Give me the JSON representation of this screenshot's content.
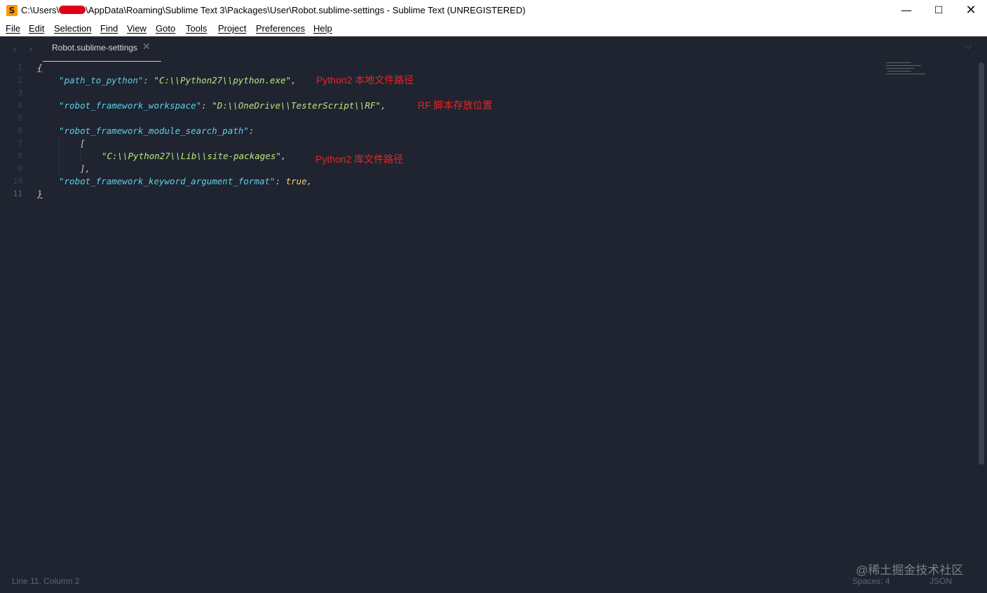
{
  "titlebar": {
    "title_prefix": "C:\\Users\\",
    "title_suffix": "\\AppData\\Roaming\\Sublime Text 3\\Packages\\User\\Robot.sublime-settings - Sublime Text (UNREGISTERED)",
    "app_icon_glyph": "S",
    "minimize": "—",
    "maximize": "☐",
    "close": "✕"
  },
  "menu": [
    "File",
    "Edit",
    "Selection",
    "Find",
    "View",
    "Goto",
    "Tools",
    "Project",
    "Preferences",
    "Help"
  ],
  "tabs": {
    "nav_back": "‹",
    "nav_forward": "›",
    "active_tab": {
      "label": "Robot.sublime-settings",
      "close": "✕"
    },
    "dropdown": "⌵"
  },
  "editor": {
    "line_numbers": [
      "1",
      "2",
      "3",
      "4",
      "5",
      "6",
      "7",
      "8",
      "9",
      "10",
      "11"
    ],
    "active_line": 11,
    "lines": {
      "l1": {
        "brace": "{"
      },
      "l2": {
        "key": "\"path_to_python\"",
        "colon": ": ",
        "value": "\"C:\\\\Python27\\\\python.exe\"",
        "comma": ","
      },
      "l4": {
        "key": "\"robot_framework_workspace\"",
        "colon": ": ",
        "value": "\"D:\\\\OneDrive\\\\TesterScript\\\\RF\"",
        "comma": ","
      },
      "l6": {
        "key": "\"robot_framework_module_search_path\"",
        "colon": ":"
      },
      "l7": {
        "bracket": "["
      },
      "l8": {
        "value": "\"C:\\\\Python27\\\\Lib\\\\site-packages\"",
        "comma": ","
      },
      "l9": {
        "bracket": "]",
        "comma": ","
      },
      "l10": {
        "key": "\"robot_framework_keyword_argument_format\"",
        "colon": ": ",
        "value": "true",
        "comma": ","
      },
      "l11": {
        "brace": "}"
      }
    },
    "annotations": {
      "python_path": "Python2 本地文件路径",
      "rf_workspace": "RF 脚本存放位置",
      "lib_path": "Python2 库文件路径"
    }
  },
  "statusbar": {
    "position": "Line 11, Column 2",
    "indent": "Spaces: 4",
    "syntax": "JSON"
  },
  "watermark": "@稀土掘金技术社区",
  "colors": {
    "background": "#1f2430",
    "key": "#5ccfe6",
    "string": "#bae67e",
    "boolean": "#ffcc66",
    "annotation": "#e82424",
    "accent": "#ffcc66"
  }
}
